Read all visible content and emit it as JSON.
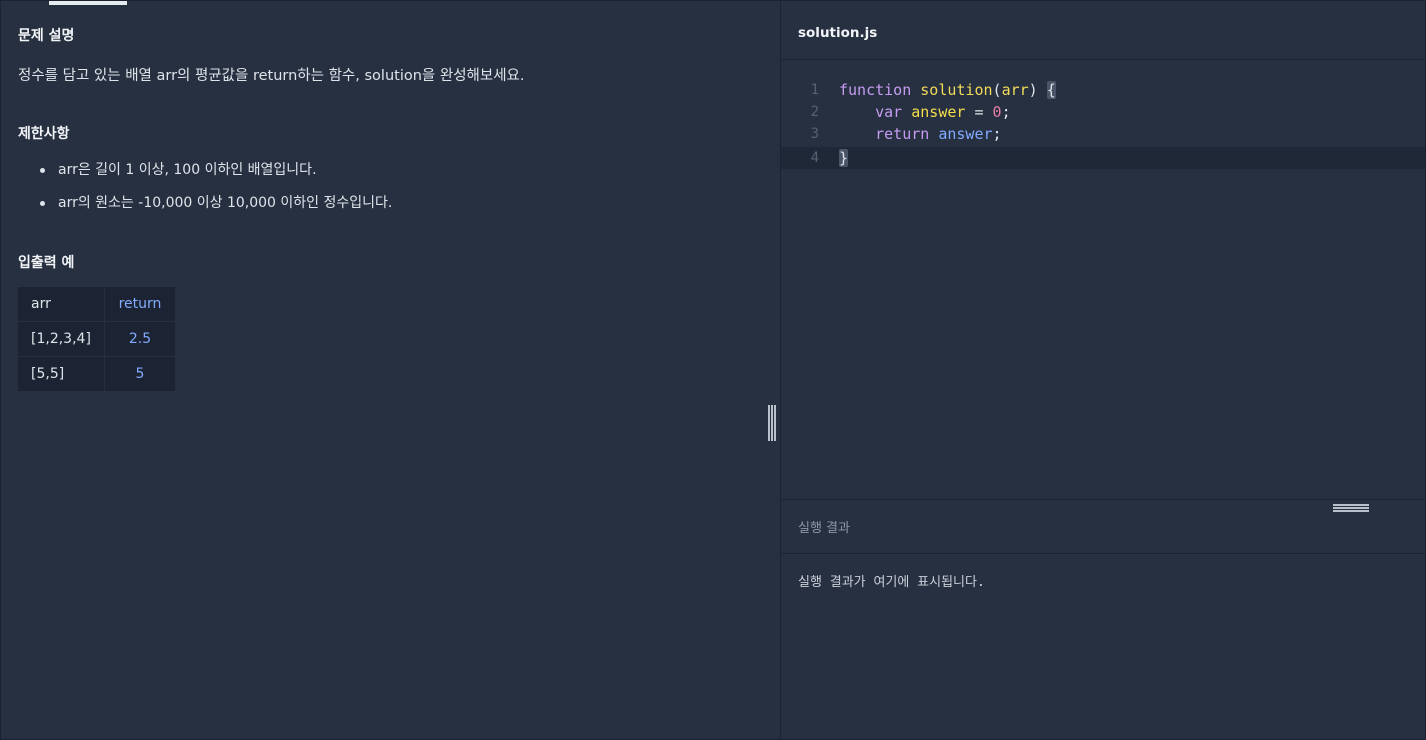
{
  "problem": {
    "description_title": "문제 설명",
    "description": "정수를 담고 있는 배열 arr의 평균값을 return하는 함수, solution을 완성해보세요.",
    "constraints_title": "제한사항",
    "constraints": [
      "arr은 길이 1 이상, 100 이하인 배열입니다.",
      "arr의 원소는 -10,000 이상 10,000 이하인 정수입니다."
    ],
    "examples_title": "입출력 예",
    "examples_table": {
      "headers": [
        "arr",
        "return"
      ],
      "rows": [
        [
          "[1,2,3,4]",
          "2.5"
        ],
        [
          "[5,5]",
          "5"
        ]
      ]
    }
  },
  "editor": {
    "file_name": "solution.js",
    "line_numbers": [
      "1",
      "2",
      "3",
      "4"
    ],
    "lines": [
      "function solution(arr) {",
      "    var answer = 0;",
      "    return answer;",
      "}"
    ]
  },
  "result": {
    "title": "실행 결과",
    "placeholder_text": "실행 결과가 여기에 표시됩니다."
  }
}
